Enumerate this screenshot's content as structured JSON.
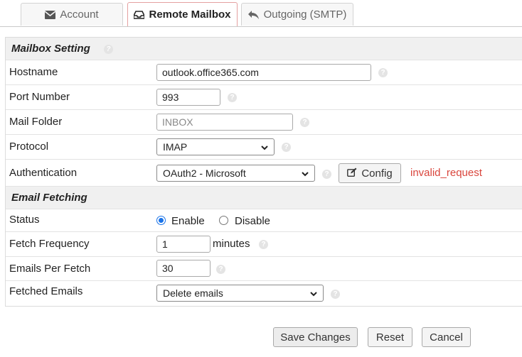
{
  "tabs": [
    {
      "label": "Account",
      "icon": "envelope-icon"
    },
    {
      "label": "Remote Mailbox",
      "icon": "inbox-icon",
      "active": true
    },
    {
      "label": "Outgoing (SMTP)",
      "icon": "reply-icon"
    }
  ],
  "mailbox_setting": {
    "title": "Mailbox Setting",
    "hostname": {
      "label": "Hostname",
      "value": "outlook.office365.com"
    },
    "port": {
      "label": "Port Number",
      "value": "993"
    },
    "folder": {
      "label": "Mail Folder",
      "placeholder": "INBOX"
    },
    "protocol": {
      "label": "Protocol",
      "selected": "IMAP"
    },
    "authentication": {
      "label": "Authentication",
      "selected": "OAuth2 - Microsoft",
      "config_label": "Config",
      "error": "invalid_request"
    }
  },
  "email_fetching": {
    "title": "Email Fetching",
    "status": {
      "label": "Status",
      "enable": "Enable",
      "disable": "Disable",
      "selected": "enable"
    },
    "frequency": {
      "label": "Fetch Frequency",
      "value": "1",
      "unit": "minutes"
    },
    "per_fetch": {
      "label": "Emails Per Fetch",
      "value": "30"
    },
    "fetched": {
      "label": "Fetched Emails",
      "selected": "Delete emails"
    }
  },
  "actions": {
    "save": "Save Changes",
    "reset": "Reset",
    "cancel": "Cancel"
  },
  "colors": {
    "error": "#d9453c",
    "radio_accent": "#1a73e8",
    "active_tab_border": "#e4a0a0"
  }
}
